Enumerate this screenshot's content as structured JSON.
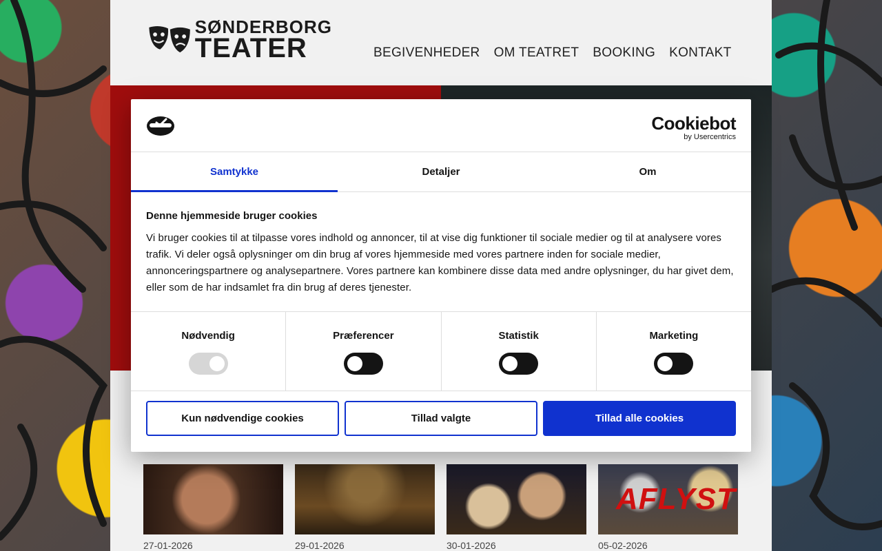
{
  "site": {
    "logo_line1": "SØNDERBORG",
    "logo_line2": "TEATER",
    "nav": [
      "BEGIVENHEDER",
      "OM TEATRET",
      "BOOKING",
      "KONTAKT"
    ]
  },
  "events": [
    {
      "date": "27-01-2026",
      "overlay": ""
    },
    {
      "date": "29-01-2026",
      "overlay": ""
    },
    {
      "date": "30-01-2026",
      "overlay": ""
    },
    {
      "date": "05-02-2026",
      "overlay": "AFLYST"
    }
  ],
  "cookie_dialog": {
    "brand_name": "Cookiebot",
    "brand_sub": "by Usercentrics",
    "tabs": [
      "Samtykke",
      "Detaljer",
      "Om"
    ],
    "active_tab": "Samtykke",
    "heading": "Denne hjemmeside bruger cookies",
    "text": "Vi bruger cookies til at tilpasse vores indhold og annoncer, til at vise dig funktioner til sociale medier og til at analysere vores trafik. Vi deler også oplysninger om din brug af vores hjemmeside med vores partnere inden for sociale medier, annonceringspartnere og analysepartnere. Vores partnere kan kombinere disse data med andre oplysninger, du har givet dem, eller som de har indsamlet fra din brug af deres tjenester.",
    "categories": [
      {
        "label": "Nødvendig",
        "state": "on-disabled"
      },
      {
        "label": "Præferencer",
        "state": "off"
      },
      {
        "label": "Statistik",
        "state": "off"
      },
      {
        "label": "Marketing",
        "state": "off"
      }
    ],
    "buttons": {
      "necessary_only": "Kun nødvendige cookies",
      "allow_selected": "Tillad valgte",
      "allow_all": "Tillad alle cookies"
    },
    "colors": {
      "accent": "#1032cf"
    }
  }
}
